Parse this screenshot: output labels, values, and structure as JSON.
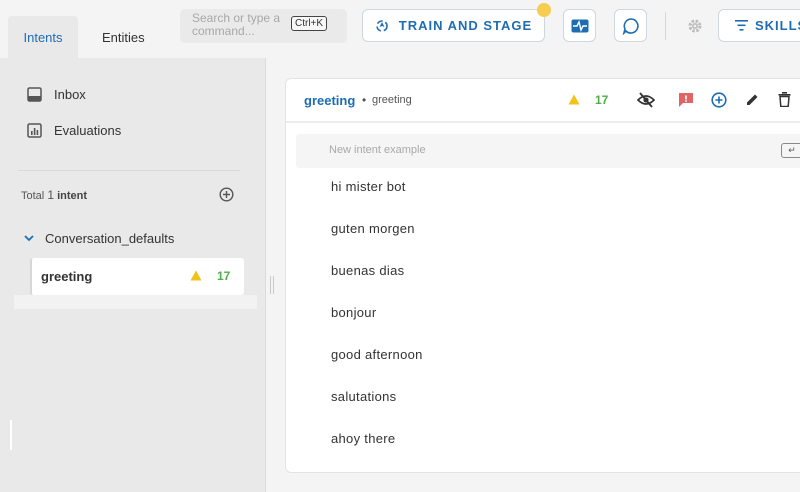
{
  "tabs": {
    "intents": "Intents",
    "entities": "Entities"
  },
  "search": {
    "placeholder": "Search or type a command...",
    "shortcut": "Ctrl+K"
  },
  "toolbar": {
    "train_label": "TRAIN AND STAGE",
    "skills_label": "SKILLS"
  },
  "sidebar": {
    "nav": [
      {
        "label": "Inbox",
        "icon": "inbox-icon"
      },
      {
        "label": "Evaluations",
        "icon": "chart-icon"
      }
    ],
    "total_prefix": "Total",
    "total_count": "1",
    "total_suffix": "intent",
    "group": "Conversation_defaults",
    "intent": {
      "name": "greeting",
      "count": "17"
    }
  },
  "card": {
    "title": "greeting",
    "bullet": "•",
    "subtitle": "greeting",
    "count": "17",
    "new_example_placeholder": "New intent example",
    "enter_hint": "↵",
    "examples": [
      "hi mister bot",
      "guten morgen",
      "buenas dias",
      "bonjour",
      "good afternoon",
      "salutations",
      "ahoy there"
    ]
  },
  "colors": {
    "accent": "#1e6db3",
    "warning": "#f2c21b",
    "success": "#4fae44",
    "flag": "#e06666",
    "notify_dot": "#f6cd4f"
  }
}
